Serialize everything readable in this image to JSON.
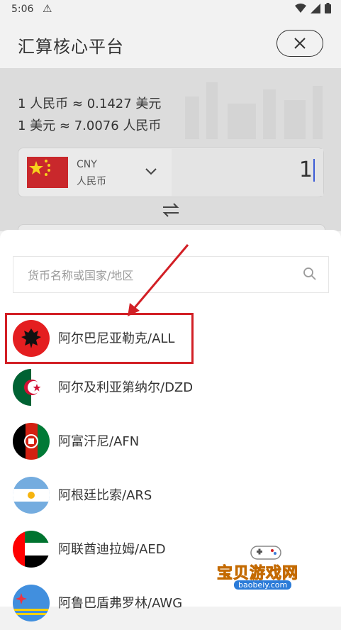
{
  "status_bar": {
    "time": "5:06",
    "warning_icon": "warning-triangle-icon"
  },
  "header": {
    "title": "汇算核心平台",
    "close_icon": "close-x-icon"
  },
  "rates": {
    "line1": "1 人民币 ≈ 0.1427 美元",
    "line2": "1 美元 ≈ 7.0076 人民币"
  },
  "from_currency": {
    "code": "CNY",
    "name": "人民币",
    "amount": "1"
  },
  "search": {
    "placeholder": "货币名称或国家/地区"
  },
  "currency_list": [
    {
      "label": "阿尔巴尼亚勒克/ALL",
      "flag": "albania-flag"
    },
    {
      "label": "阿尔及利亚第纳尔/DZD",
      "flag": "algeria-flag"
    },
    {
      "label": "阿富汗尼/AFN",
      "flag": "afghanistan-flag"
    },
    {
      "label": "阿根廷比索/ARS",
      "flag": "argentina-flag"
    },
    {
      "label": "阿联酋迪拉姆/AED",
      "flag": "uae-flag"
    },
    {
      "label": "阿鲁巴盾弗罗林/AWG",
      "flag": "aruba-flag"
    }
  ],
  "watermark": {
    "brand": "宝贝游戏网",
    "site": "baobeiy.com"
  },
  "colors": {
    "highlight": "#d21f25",
    "caret": "#3b5bd6"
  }
}
